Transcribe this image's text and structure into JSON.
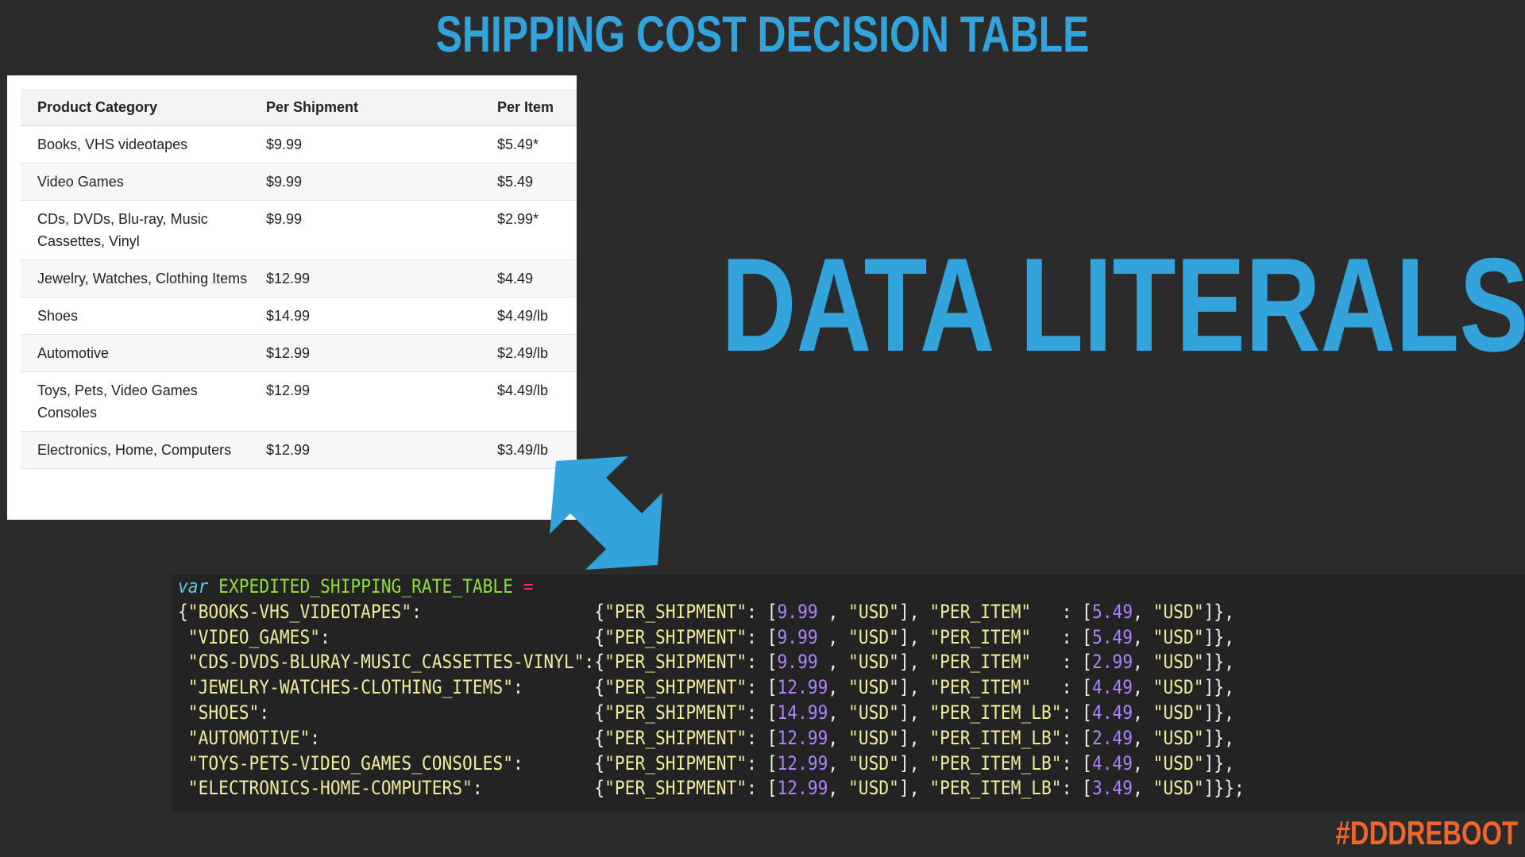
{
  "title": "SHIPPING COST DECISION TABLE",
  "headline": "DATA LITERALS!",
  "hashtag": "#DDDREBOOT",
  "table": {
    "headers": [
      "Product Category",
      "Per Shipment",
      "Per Item"
    ],
    "rows": [
      [
        "Books, VHS videotapes",
        "$9.99",
        "$5.49*"
      ],
      [
        "Video Games",
        "$9.99",
        "$5.49"
      ],
      [
        "CDs, DVDs, Blu-ray, Music Cassettes, Vinyl",
        "$9.99",
        "$2.99*"
      ],
      [
        "Jewelry, Watches, Clothing Items",
        "$12.99",
        "$4.49"
      ],
      [
        "Shoes",
        "$14.99",
        "$4.49/lb"
      ],
      [
        "Automotive",
        "$12.99",
        "$2.49/lb"
      ],
      [
        "Toys, Pets, Video Games Consoles",
        "$12.99",
        "$4.49/lb"
      ],
      [
        "Electronics, Home, Computers",
        "$12.99",
        "$3.49/lb"
      ]
    ]
  },
  "code": {
    "keyword": "var",
    "var_name": "EXPEDITED_SHIPPING_RATE_TABLE",
    "operator": "=",
    "lines": [
      {
        "key": "\"BOOKS-VHS_VIDEOTAPES\"",
        "ship": "9.99",
        "item_key": "\"PER_ITEM\"",
        "item": "5.49"
      },
      {
        "key": "\"VIDEO_GAMES\"",
        "ship": "9.99",
        "item_key": "\"PER_ITEM\"",
        "item": "5.49"
      },
      {
        "key": "\"CDS-DVDS-BLURAY-MUSIC_CASSETTES-VINYL\"",
        "ship": "9.99",
        "item_key": "\"PER_ITEM\"",
        "item": "2.99"
      },
      {
        "key": "\"JEWELRY-WATCHES-CLOTHING_ITEMS\"",
        "ship": "12.99",
        "item_key": "\"PER_ITEM\"",
        "item": "4.49"
      },
      {
        "key": "\"SHOES\"",
        "ship": "14.99",
        "item_key": "\"PER_ITEM_LB\"",
        "item": "4.49"
      },
      {
        "key": "\"AUTOMOTIVE\"",
        "ship": "12.99",
        "item_key": "\"PER_ITEM_LB\"",
        "item": "2.49"
      },
      {
        "key": "\"TOYS-PETS-VIDEO_GAMES_CONSOLES\"",
        "ship": "12.99",
        "item_key": "\"PER_ITEM_LB\"",
        "item": "4.49"
      },
      {
        "key": "\"ELECTRONICS-HOME-COMPUTERS\"",
        "ship": "12.99",
        "item_key": "\"PER_ITEM_LB\"",
        "item": "3.49"
      }
    ],
    "ship_key": "\"PER_SHIPMENT\"",
    "currency": "\"USD\""
  },
  "colors": {
    "accent": "#33a3dc",
    "hashtag": "#f0642e",
    "background": "#2b2b2b"
  },
  "icons": {
    "arrow": "double-headed-diagonal-arrow-icon"
  }
}
